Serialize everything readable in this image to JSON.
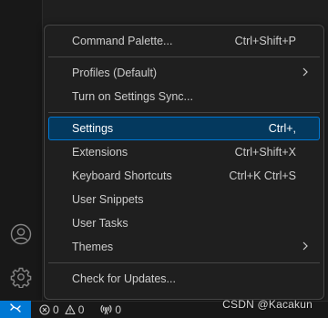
{
  "menu": {
    "groups": [
      [
        {
          "label": "Command Palette...",
          "shortcut": "Ctrl+Shift+P"
        }
      ],
      [
        {
          "label": "Profiles (Default)",
          "shortcut": "",
          "submenu": true
        },
        {
          "label": "Turn on Settings Sync...",
          "shortcut": ""
        }
      ],
      [
        {
          "label": "Settings",
          "shortcut": "Ctrl+,",
          "selected": true
        },
        {
          "label": "Extensions",
          "shortcut": "Ctrl+Shift+X"
        },
        {
          "label": "Keyboard Shortcuts",
          "shortcut": "Ctrl+K Ctrl+S"
        },
        {
          "label": "User Snippets",
          "shortcut": ""
        },
        {
          "label": "User Tasks",
          "shortcut": ""
        },
        {
          "label": "Themes",
          "shortcut": "",
          "submenu": true
        }
      ],
      [
        {
          "label": "Check for Updates...",
          "shortcut": ""
        }
      ]
    ]
  },
  "status_bar": {
    "errors": "0",
    "warnings": "0",
    "ports": "0",
    "remote_icon": "remote-icon"
  },
  "activity_bar": {
    "account_icon": "account-icon",
    "manage_icon": "gear-icon"
  },
  "watermark": "CSDN @Kacakun",
  "colors": {
    "selection_bg": "#04395e",
    "selection_border": "#0078d4",
    "remote_bg": "#0078d4"
  }
}
